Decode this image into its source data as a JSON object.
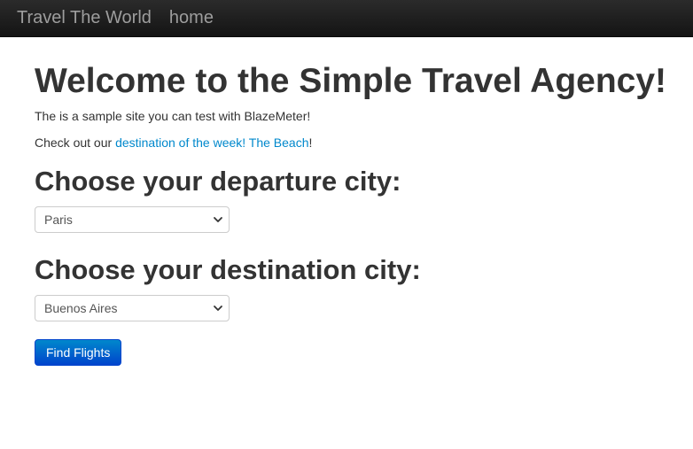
{
  "navbar": {
    "brand": "Travel The World",
    "home": "home"
  },
  "main": {
    "heading": "Welcome to the Simple Travel Agency!",
    "intro": "The is a sample site you can test with BlazeMeter!",
    "week_prefix": "Check out our ",
    "week_link": "destination of the week! The Beach",
    "week_suffix": "!",
    "departure_heading": "Choose your departure city:",
    "departure_value": "Paris",
    "destination_heading": "Choose your destination city:",
    "destination_value": "Buenos Aires",
    "find_button": "Find Flights"
  },
  "icons": {
    "select_caret": "chevron-down-icon"
  },
  "colors": {
    "navbar_bg": "#1b1b1b",
    "nav_text": "#9d9d9d",
    "link": "#0088cc",
    "button": "#0055cc"
  }
}
